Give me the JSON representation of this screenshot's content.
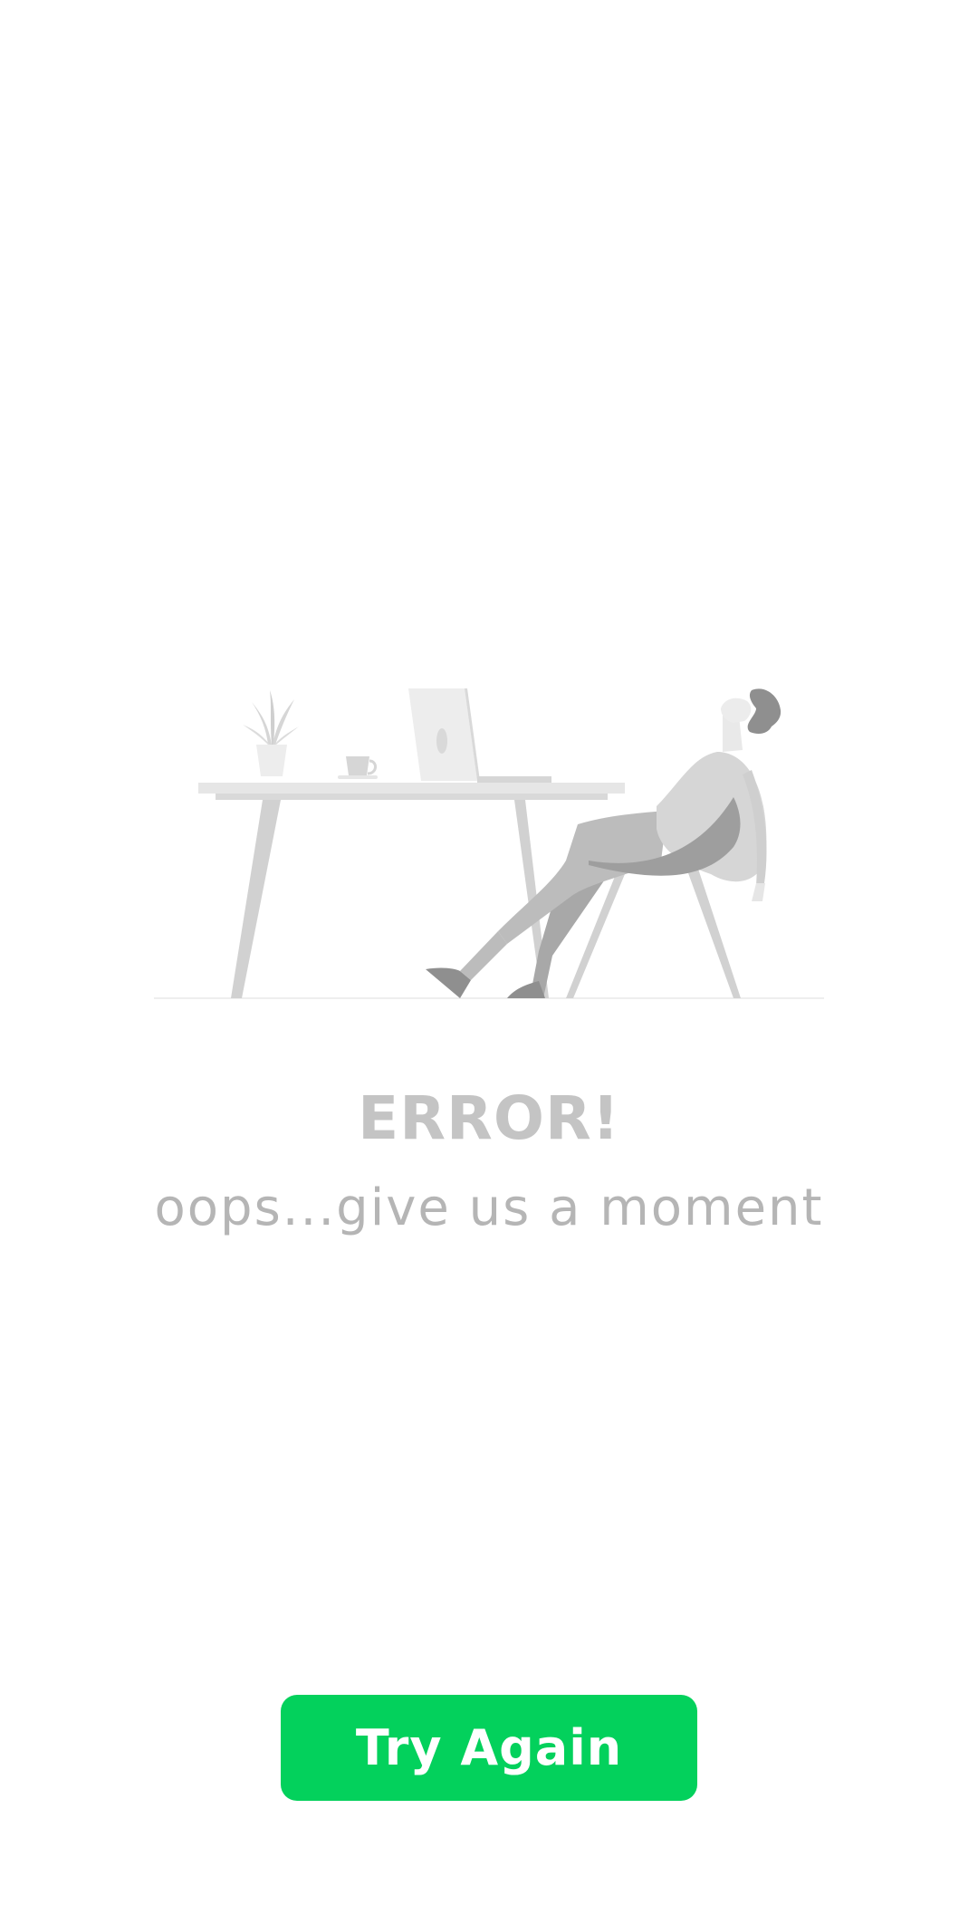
{
  "error_screen": {
    "title": "ERROR!",
    "subtitle": "oops...give us a moment",
    "button_label": "Try Again"
  },
  "colors": {
    "background": "#ffffff",
    "title": "#c4c4c4",
    "subtitle": "#b5b5b5",
    "button": "#03d15c",
    "button_text": "#ffffff"
  },
  "illustration": {
    "name": "tired-person-at-desk-illustration"
  }
}
